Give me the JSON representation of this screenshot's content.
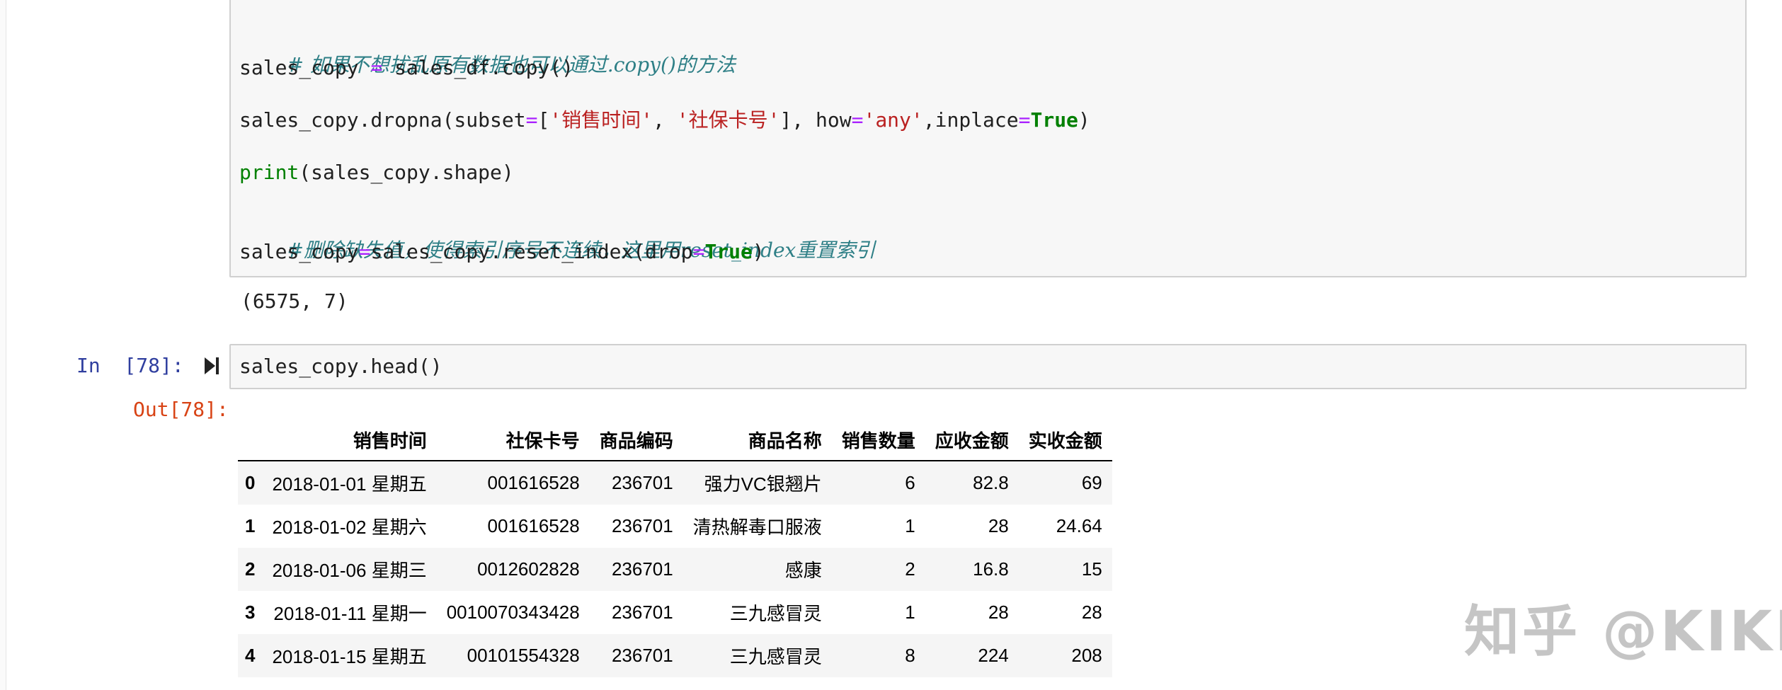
{
  "cell1": {
    "line1_comment": "# 如果不想扰乱原有数据也可以通过.copy()的方法",
    "line2_a": "sales_copy ",
    "line2_op": "=",
    "line2_b": " sales_df.copy()",
    "line3_a": "sales_copy.dropna(subset",
    "line3_op1": "=",
    "line3_b": "[",
    "line3_s1": "'销售时间'",
    "line3_c": ", ",
    "line3_s2": "'社保卡号'",
    "line3_d": "], how",
    "line3_op2": "=",
    "line3_s3": "'any'",
    "line3_e": ",inplace",
    "line3_op3": "=",
    "line3_kw": "True",
    "line3_f": ")",
    "line4_builtin": "print",
    "line4_rest": "(sales_copy.shape)",
    "line5_comment": "#删除缺失值，使得索引序号不连续，这里用reset_index重置索引",
    "line6_a": "sales_copy",
    "line6_op1": "=",
    "line6_b": "sales_copy.reset_index(drop",
    "line6_op2": "=",
    "line6_kw": "True",
    "line6_c": ")"
  },
  "cell1_output": "(6575, 7)",
  "cell2": {
    "prompt_in": "In  [78]:",
    "code": "sales_copy.head()",
    "prompt_out": "Out[78]:"
  },
  "table": {
    "columns": [
      "",
      "销售时间",
      "社保卡号",
      "商品编码",
      "商品名称",
      "销售数量",
      "应收金额",
      "实收金额"
    ],
    "rows": [
      [
        "0",
        "2018-01-01 星期五",
        "001616528",
        "236701",
        "强力VC银翘片",
        "6",
        "82.8",
        "69"
      ],
      [
        "1",
        "2018-01-02 星期六",
        "001616528",
        "236701",
        "清热解毒口服液",
        "1",
        "28",
        "24.64"
      ],
      [
        "2",
        "2018-01-06 星期三",
        "0012602828",
        "236701",
        "感康",
        "2",
        "16.8",
        "15"
      ],
      [
        "3",
        "2018-01-11 星期一",
        "0010070343428",
        "236701",
        "三九感冒灵",
        "1",
        "28",
        "28"
      ],
      [
        "4",
        "2018-01-15 星期五",
        "00101554328",
        "236701",
        "三九感冒灵",
        "8",
        "224",
        "208"
      ]
    ]
  },
  "watermark": "知乎 @KIKI",
  "icons": {
    "run": "run-cell-icon"
  }
}
